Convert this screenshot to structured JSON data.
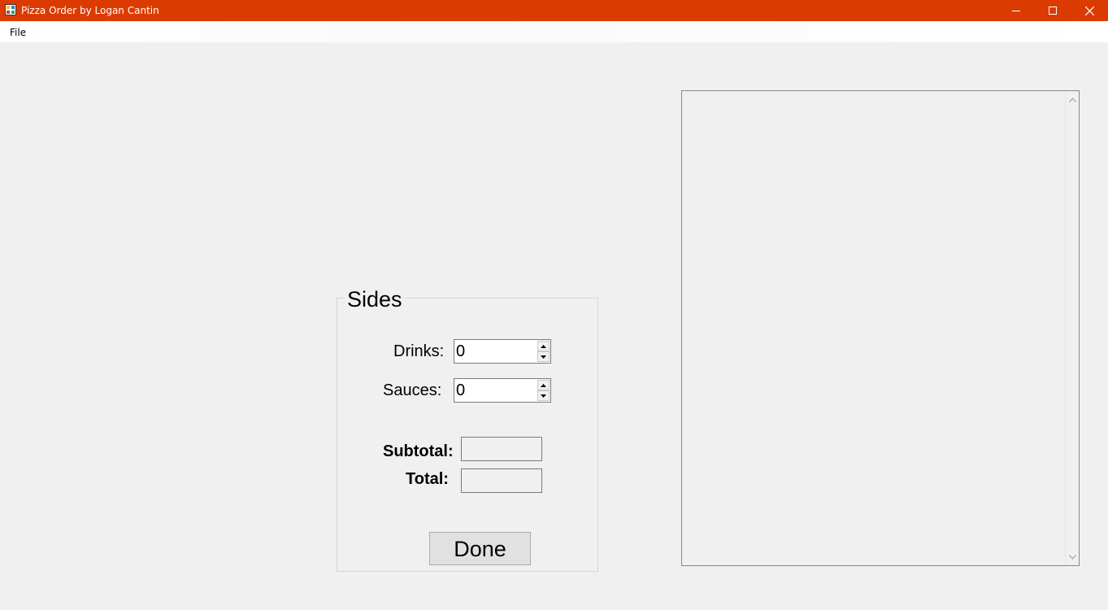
{
  "window": {
    "title": "Pizza Order by Logan Cantin",
    "app_icon": "app-icon",
    "controls": [
      "minimize-icon",
      "maximize-icon",
      "close-icon"
    ],
    "title_bar_color": "#db3b00"
  },
  "menu": {
    "file_label": "File"
  },
  "sides": {
    "title": "Sides",
    "drinks_label": "Drinks:",
    "drinks_value": "0",
    "sauces_label": "Sauces:",
    "sauces_value": "0",
    "subtotal_label": "Subtotal:",
    "subtotal_value": "",
    "total_label": "Total:",
    "total_value": "",
    "done_label": "Done"
  },
  "output": {
    "text": ""
  }
}
